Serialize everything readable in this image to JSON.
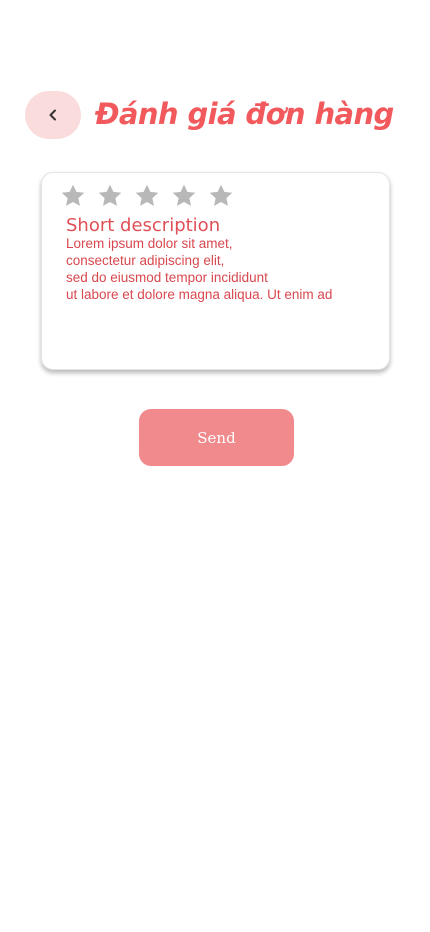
{
  "header": {
    "back_icon": "chevron-left-icon",
    "title": "Đánh giá đơn hàng"
  },
  "review": {
    "rating": 0,
    "max_rating": 5,
    "star_icon": "star-icon",
    "star_color": "#b8b8b8",
    "description_title": "Short description",
    "description_text": "Lorem ipsum dolor sit amet,\nconsectetur adipiscing elit,\nsed do eiusmod tempor incididunt\nut labore et dolore magna aliqua. Ut enim ad"
  },
  "actions": {
    "send_label": "Send"
  },
  "colors": {
    "accent": "#f2595c",
    "back_button_bg": "#fbdcdc",
    "send_button_bg": "#f08a8c"
  }
}
